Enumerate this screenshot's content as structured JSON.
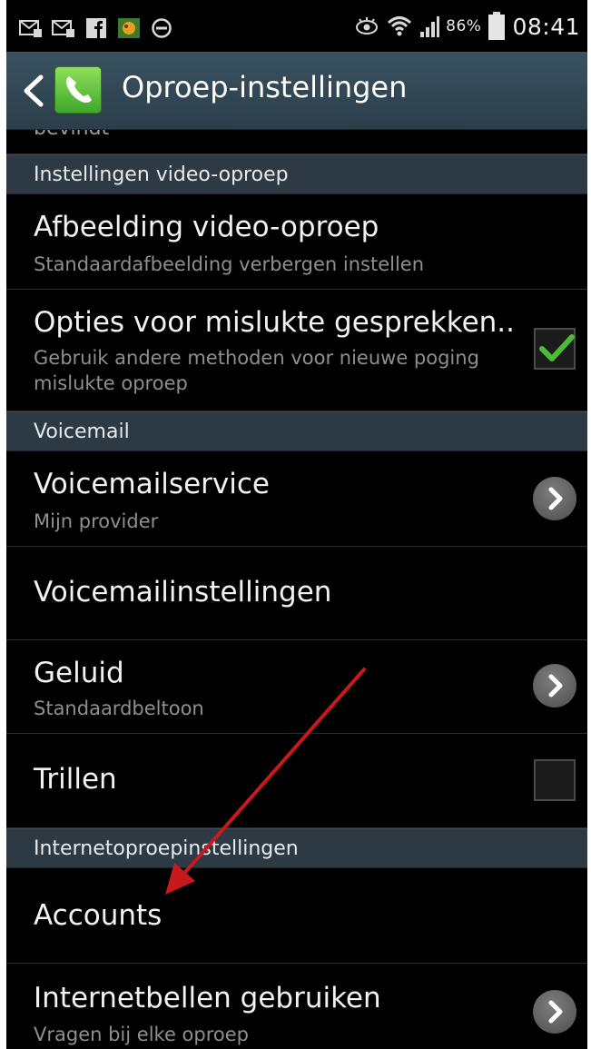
{
  "status_bar": {
    "battery_percent": "86%",
    "time": "08:41",
    "left_icons": [
      "message-icon",
      "message-icon",
      "facebook-icon",
      "app-notification-icon",
      "do-not-disturb-icon"
    ],
    "right_icons": [
      "smart-stay-eye-icon",
      "wifi-icon",
      "signal-icon",
      "battery-icon"
    ]
  },
  "action_bar": {
    "title": "Oproep-instellingen",
    "accent": "#4cbb35"
  },
  "list": {
    "clipped_text": "bevindt",
    "section_video": "Instellingen video-oproep",
    "item_video_image": {
      "title": "Afbeelding video-oproep",
      "subtitle": "Standaardafbeelding verbergen instellen"
    },
    "item_failed_calls": {
      "title": "Opties voor mislukte gesprekken..",
      "subtitle": "Gebruik andere methoden voor nieuwe poging mislukte oproep",
      "checked": true
    },
    "section_voicemail": "Voicemail",
    "item_voicemail_service": {
      "title": "Voicemailservice",
      "subtitle": "Mijn provider"
    },
    "item_voicemail_settings": {
      "title": "Voicemailinstellingen"
    },
    "item_sound": {
      "title": "Geluid",
      "subtitle": "Standaardbeltoon"
    },
    "item_vibrate": {
      "title": "Trillen",
      "checked": false
    },
    "section_internet": "Internetoproepinstellingen",
    "item_accounts": {
      "title": "Accounts"
    },
    "item_internet_calling": {
      "title": "Internetbellen gebruiken",
      "subtitle": "Vragen bij elke oproep"
    }
  },
  "annotation": {
    "arrow_color": "#c8191c",
    "points_to": "Accounts"
  }
}
